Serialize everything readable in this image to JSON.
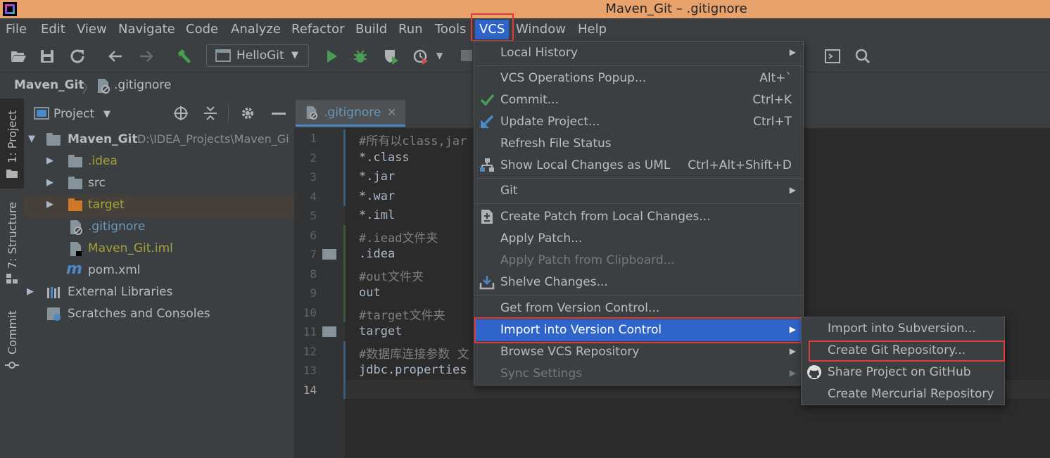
{
  "window": {
    "title": "Maven_Git – .gitignore"
  },
  "menubar": [
    {
      "key": "file",
      "label": "File"
    },
    {
      "key": "edit",
      "label": "Edit"
    },
    {
      "key": "view",
      "label": "View"
    },
    {
      "key": "navigate",
      "label": "Navigate"
    },
    {
      "key": "code",
      "label": "Code"
    },
    {
      "key": "analyze",
      "label": "Analyze"
    },
    {
      "key": "refactor",
      "label": "Refactor"
    },
    {
      "key": "build",
      "label": "Build"
    },
    {
      "key": "run",
      "label": "Run"
    },
    {
      "key": "tools",
      "label": "Tools"
    },
    {
      "key": "vcs",
      "label": "VCS"
    },
    {
      "key": "window",
      "label": "Window"
    },
    {
      "key": "help",
      "label": "Help"
    }
  ],
  "toolbar": {
    "run_config": "HelloGit"
  },
  "breadcrumb": {
    "project": "Maven_Git",
    "file": ".gitignore"
  },
  "left_strip": {
    "project_tab": "1: Project",
    "structure_tab": "7: Structure",
    "commit_tab": "Commit"
  },
  "project_panel": {
    "title": "Project",
    "tree": [
      {
        "label": "Maven_Git",
        "path": "D:\\IDEA_Projects\\Maven_Gi"
      },
      {
        "label": ".idea"
      },
      {
        "label": "src"
      },
      {
        "label": "target"
      },
      {
        "label": ".gitignore"
      },
      {
        "label": "Maven_Git.iml"
      },
      {
        "label": "pom.xml"
      },
      {
        "label": "External Libraries"
      },
      {
        "label": "Scratches and Consoles"
      }
    ]
  },
  "editor": {
    "tab": ".gitignore",
    "line_numbers": [
      "1",
      "2",
      "3",
      "4",
      "5",
      "6",
      "7",
      "8",
      "9",
      "10",
      "11",
      "12",
      "13",
      "14"
    ],
    "lines": [
      "#所有以class,jar",
      "*.class",
      "*.jar",
      "*.war",
      "*.iml",
      "#.iead文件夹",
      ".idea",
      "#out文件夹",
      "out",
      "#target文件夹",
      "target",
      "#数据库连接参数 文",
      "jdbc.properties",
      ""
    ]
  },
  "vcs_menu": {
    "items": [
      {
        "label": "Local History",
        "shortcut": "",
        "submenu": true
      },
      {
        "label": "VCS Operations Popup...",
        "shortcut": "Alt+`"
      },
      {
        "label": "Commit...",
        "shortcut": "Ctrl+K"
      },
      {
        "label": "Update Project...",
        "shortcut": "Ctrl+T"
      },
      {
        "label": "Refresh File Status",
        "shortcut": ""
      },
      {
        "label": "Show Local Changes as UML",
        "shortcut": "Ctrl+Alt+Shift+D"
      },
      {
        "label": "Git",
        "shortcut": "",
        "submenu": true
      },
      {
        "label": "Create Patch from Local Changes...",
        "shortcut": ""
      },
      {
        "label": "Apply Patch...",
        "shortcut": ""
      },
      {
        "label": "Apply Patch from Clipboard...",
        "shortcut": "",
        "disabled": true
      },
      {
        "label": "Shelve Changes...",
        "shortcut": ""
      },
      {
        "label": "Get from Version Control...",
        "shortcut": ""
      },
      {
        "label": "Import into Version Control",
        "shortcut": "",
        "submenu": true,
        "selected": true
      },
      {
        "label": "Browse VCS Repository",
        "shortcut": "",
        "submenu": true
      },
      {
        "label": "Sync Settings",
        "shortcut": "",
        "submenu": true,
        "disabled": true
      }
    ]
  },
  "import_submenu": {
    "items": [
      {
        "label": "Import into Subversion..."
      },
      {
        "label": "Create Git Repository..."
      },
      {
        "label": "Share Project on GitHub"
      },
      {
        "label": "Create Mercurial Repository"
      }
    ]
  },
  "colors": {
    "accent": "#2f65ca",
    "highlight_box": "#e03b3b",
    "title_bar": "#e8a36d",
    "run_green": "#499c54",
    "excluded_folder": "#d0782a"
  }
}
